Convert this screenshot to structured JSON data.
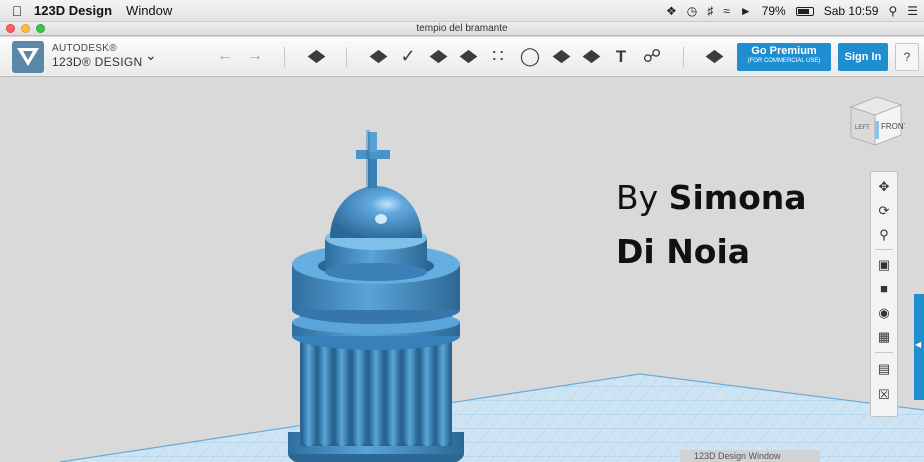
{
  "menubar": {
    "apple_icon": "apple-icon",
    "app_name": "123D Design",
    "menu_window": "Window",
    "battery": "79%",
    "clock": "Sab 10:59",
    "icons": [
      "dropbox-icon",
      "time-machine-icon",
      "bluetooth-icon",
      "wifi-icon",
      "volume-icon",
      "battery-icon",
      "spotlight-icon",
      "notification-center-icon"
    ]
  },
  "window": {
    "title": "tempio del bramante"
  },
  "toolbar": {
    "brand_top": "AUTODESK®",
    "brand_bottom": "123D® DESIGN",
    "premium_label": "Go Premium",
    "premium_sub": "(FOR COMMERCIAL USE)",
    "signin_label": "Sign In",
    "help_label": "?",
    "text_tool": "T"
  },
  "viewport": {
    "caption_by": "By",
    "caption_name1": "Simona",
    "caption_name2": "Di Noia",
    "viewcube_left": "LEFT",
    "viewcube_front": "FRONT",
    "taskbar_text": "123D Design Window"
  },
  "colors": {
    "accent": "#1e8ed0",
    "model_blue": "#4a93c9",
    "grid": "#8fc4e8"
  }
}
